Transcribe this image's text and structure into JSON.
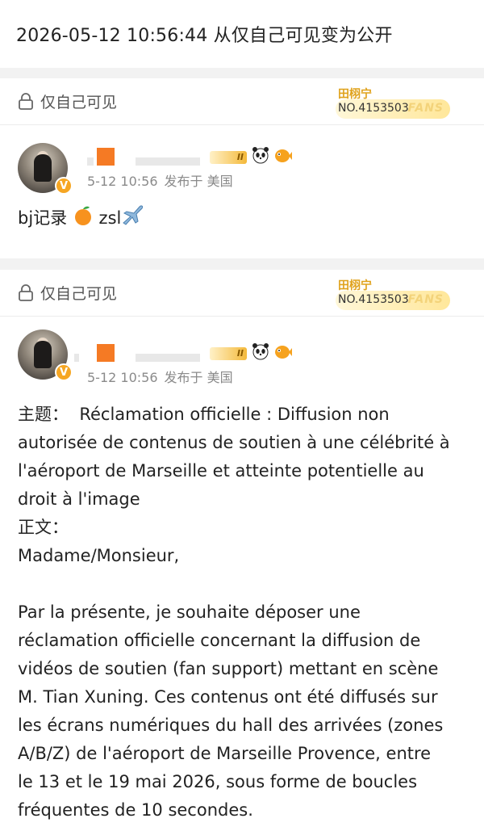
{
  "header": {
    "text": "2026-05-12 10:56:44 从仅自己可见变为公开"
  },
  "posts": [
    {
      "visibility_label": "仅自己可见",
      "fan_badge": {
        "name": "田栩宁",
        "number": "NO.4153503",
        "fans_label": "FANS"
      },
      "level_label": "II",
      "time": "5-12 10:56",
      "posted_from": "发布于 美国",
      "text_prefix": "bj记录",
      "text_suffix": "zsl"
    },
    {
      "visibility_label": "仅自己可见",
      "fan_badge": {
        "name": "田栩宁",
        "number": "NO.4153503",
        "fans_label": "FANS"
      },
      "level_label": "II",
      "time": "5-12 10:56",
      "posted_from": "发布于 美国",
      "lines": [
        "主题：  Réclamation officielle : Diffusion non",
        "autorisée de contenus de soutien à une célébrité à",
        "l'aéroport de Marseille et atteinte potentielle au",
        "droit à l'image",
        "正文：",
        "Madame/Monsieur,",
        "",
        "Par la présente, je souhaite déposer une",
        "réclamation officielle concernant la diffusion de",
        "vidéos de soutien (fan support) mettant en scène",
        "M. Tian Xuning. Ces contenus ont été diffusés sur",
        "les écrans numériques du hall des arrivées (zones",
        "A/B/Z) de l'aéroport de Marseille Provence, entre",
        "le 13 et le 19 mai 2026, sous forme de boucles",
        "fréquentes de 10 secondes."
      ]
    }
  ],
  "icons": {
    "lock": "lock-icon",
    "verified": "verified-v-icon",
    "orange": "orange-emoji-icon",
    "airplane": "airplane-emoji-icon",
    "panda": "panda-icon",
    "fish": "pufferfish-icon"
  },
  "colors": {
    "accent_orange": "#f57a24",
    "badge_gold": "#e0a21c",
    "meta_gray": "#8a8a8a"
  }
}
